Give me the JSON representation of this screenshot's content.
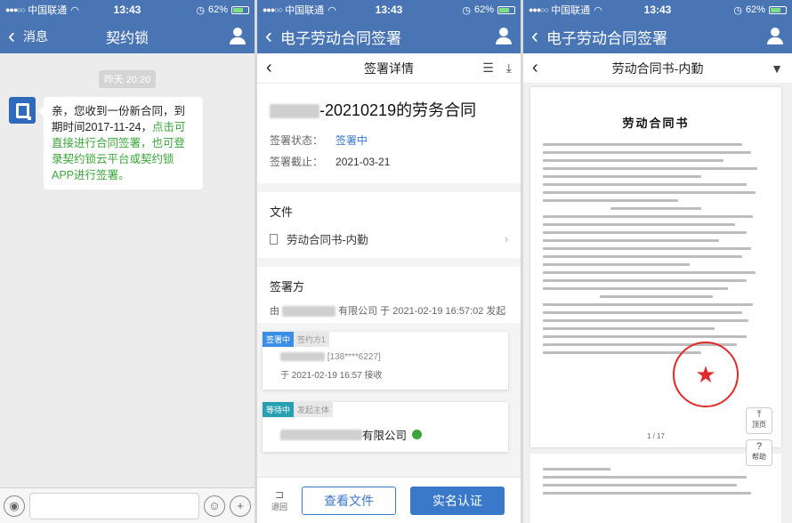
{
  "status": {
    "carrier": "中国联通",
    "time": "13:43",
    "battery": "62%",
    "battery_level": 0.62
  },
  "screen1": {
    "back_label": "消息",
    "title": "契约锁",
    "timestamp": "昨天 20:20",
    "message_plain": "亲，您收到一份新合同，到期时间2017-11-24，",
    "message_link": "点击可直接进行合同签署，也可登录契约锁云平台或契约锁APP进行签署。"
  },
  "screen2": {
    "nav_title": "电子劳动合同签署",
    "sub_title": "签署详情",
    "contract_title": "-20210219的劳务合同",
    "status_label": "签署状态：",
    "status_value": "签署中",
    "deadline_label": "签署截止：",
    "deadline_value": "2021-03-21",
    "file_section": "文件",
    "file_name": "劳动合同书-内勤",
    "signer_section": "签署方",
    "initiator_prefix": "由",
    "initiator_suffix": "有限公司 于 2021-02-19 16:57:02 发起",
    "signer1": {
      "tag_status": "签署中",
      "tag_role": "签约方1",
      "phone": "[138****6227]",
      "received": "于 2021-02-19 16:57 接收"
    },
    "signer2": {
      "tag_status": "等待中",
      "tag_role": "发起主体",
      "company_suffix": "有限公司"
    },
    "back_btn": "退回",
    "view_btn": "查看文件",
    "verify_btn": "实名认证"
  },
  "screen3": {
    "nav_title": "电子劳动合同签署",
    "sub_title": "劳动合同书-内勤",
    "doc_heading": "劳动合同书",
    "page_no": "1 / 17",
    "top_btn": "顶页",
    "help_btn": "帮助"
  }
}
